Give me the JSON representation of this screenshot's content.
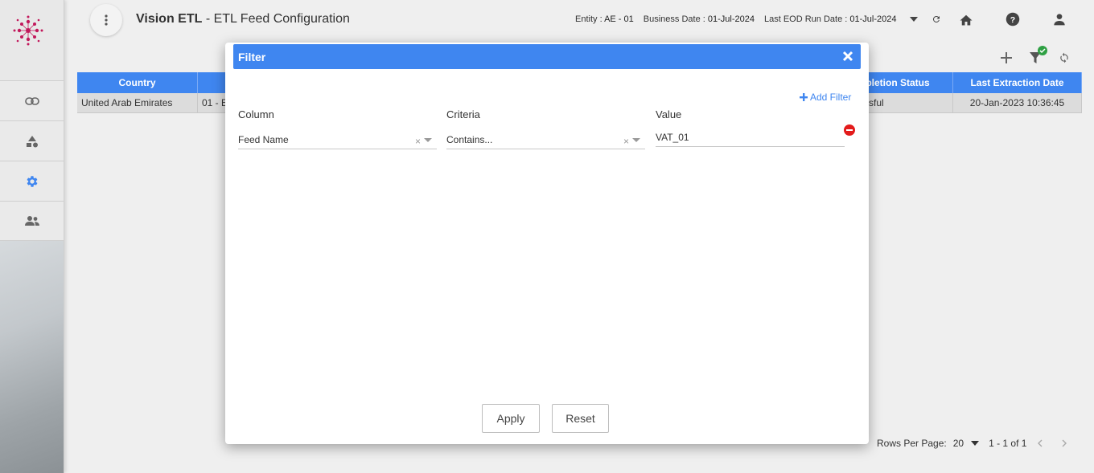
{
  "header": {
    "app_name": "Vision ETL",
    "page_title": " - ETL Feed Configuration",
    "entity_label": "Entity :",
    "entity_value": "AE - 01",
    "business_date_label": "Business Date :",
    "business_date_value": "01-Jul-2024",
    "eod_label": "Last EOD Run Date :",
    "eod_value": "01-Jul-2024"
  },
  "sidebar": {
    "items": [
      {
        "icon": "link-icon"
      },
      {
        "icon": "shapes-icon"
      },
      {
        "icon": "gear-icon"
      },
      {
        "icon": "users-icon"
      }
    ]
  },
  "table": {
    "columns": [
      "Country",
      "",
      "Completion Status",
      "Last Extraction Date"
    ],
    "visible_header_fragments": [
      "Country",
      "npletion Status",
      "Last Extraction Date"
    ],
    "rows": [
      {
        "country": "United Arab Emirates",
        "feed": "01 - E",
        "status": "sful",
        "last_extraction": "20-Jan-2023 10:36:45"
      }
    ]
  },
  "pagination": {
    "rows_per_page_label": "Rows Per Page:",
    "rows_per_page_value": "20",
    "range": "1 - 1 of 1"
  },
  "filter_dialog": {
    "title": "Filter",
    "add_filter_label": "Add Filter",
    "column_header": "Column",
    "criteria_header": "Criteria",
    "value_header": "Value",
    "column_value": "Feed Name",
    "criteria_value": "Contains...",
    "value_value": "VAT_01",
    "apply_label": "Apply",
    "reset_label": "Reset"
  },
  "colors": {
    "primary": "#3f86f0",
    "danger": "#e31b1b",
    "success": "#2ea043",
    "logo": "#c2185b"
  }
}
